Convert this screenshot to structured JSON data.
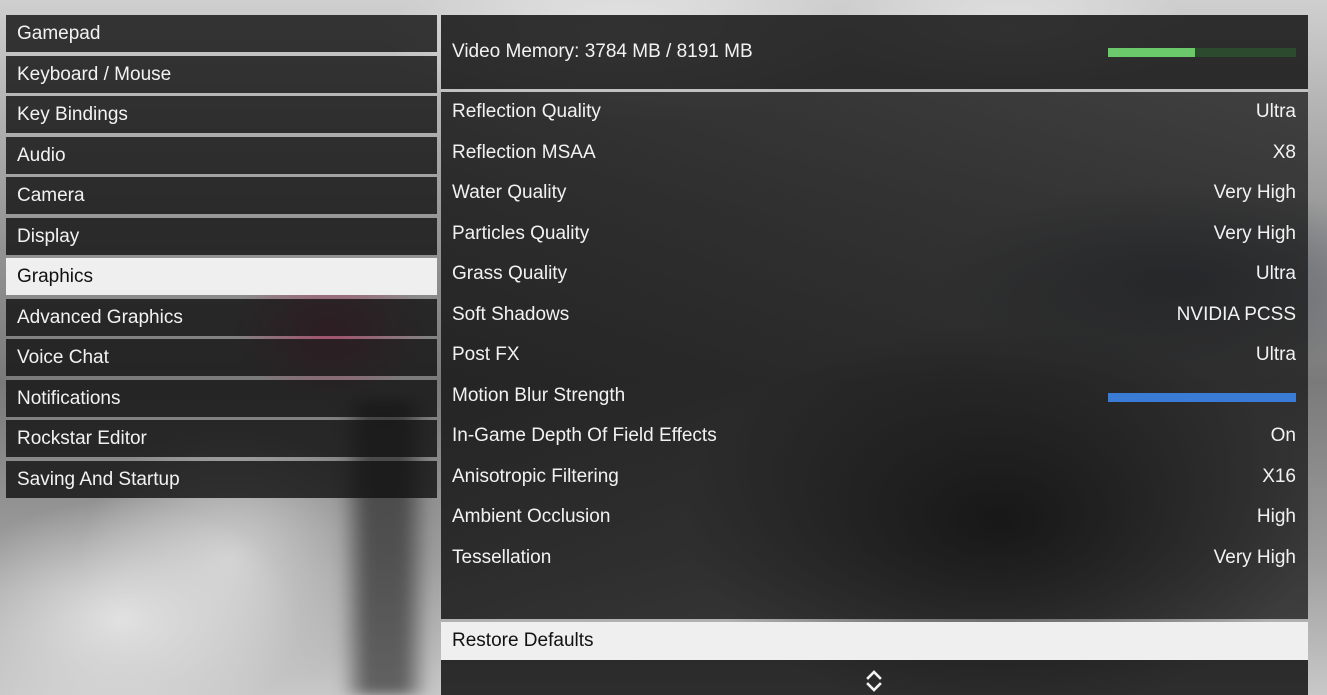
{
  "menu": {
    "items": [
      {
        "label": "Gamepad",
        "active": false
      },
      {
        "label": "Keyboard / Mouse",
        "active": false
      },
      {
        "label": "Key Bindings",
        "active": false
      },
      {
        "label": "Audio",
        "active": false
      },
      {
        "label": "Camera",
        "active": false
      },
      {
        "label": "Display",
        "active": false
      },
      {
        "label": "Graphics",
        "active": true
      },
      {
        "label": "Advanced Graphics",
        "active": false
      },
      {
        "label": "Voice Chat",
        "active": false
      },
      {
        "label": "Notifications",
        "active": false
      },
      {
        "label": "Rockstar Editor",
        "active": false
      },
      {
        "label": "Saving And Startup",
        "active": false
      }
    ]
  },
  "vram": {
    "label": "Video Memory: 3784 MB / 8191 MB",
    "fill_fraction": 0.462,
    "fill_color": "#6bc96b"
  },
  "settings": {
    "rows": [
      {
        "label": "Reflection Quality",
        "value": "Ultra"
      },
      {
        "label": "Reflection MSAA",
        "value": "X8"
      },
      {
        "label": "Water Quality",
        "value": "Very High"
      },
      {
        "label": "Particles Quality",
        "value": "Very High"
      },
      {
        "label": "Grass Quality",
        "value": "Ultra"
      },
      {
        "label": "Soft Shadows",
        "value": "NVIDIA PCSS"
      },
      {
        "label": "Post FX",
        "value": "Ultra"
      },
      {
        "label": "Motion Blur Strength",
        "slider_fraction": 1.0
      },
      {
        "label": "In-Game Depth Of Field Effects",
        "value": "On"
      },
      {
        "label": "Anisotropic Filtering",
        "value": "X16"
      },
      {
        "label": "Ambient Occlusion",
        "value": "High"
      },
      {
        "label": "Tessellation",
        "value": "Very High"
      }
    ],
    "slider_color": "#3a7bd5"
  },
  "restore": {
    "label": "Restore Defaults"
  },
  "icons": {
    "scroll": "up-down-chevron-icon"
  }
}
